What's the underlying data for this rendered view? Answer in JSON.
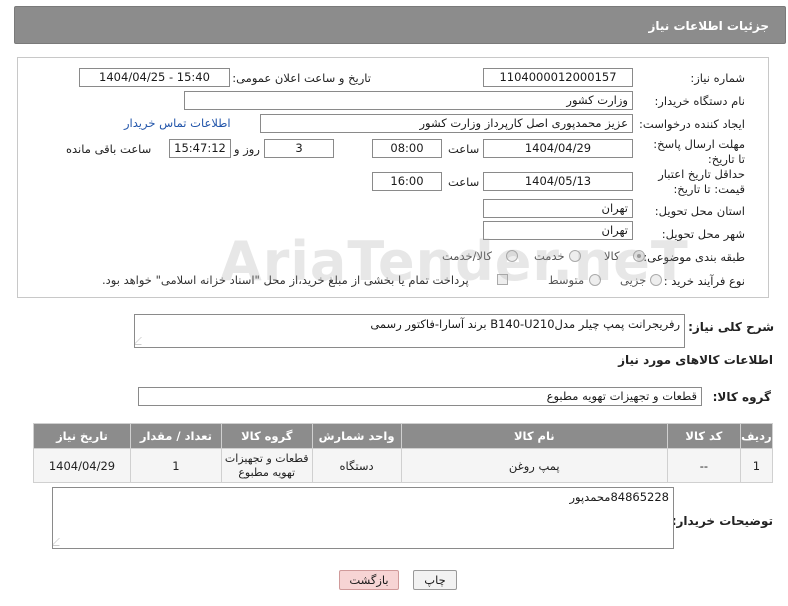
{
  "header": {
    "title": "جزئیات اطلاعات نیاز"
  },
  "form": {
    "need_number_label": "شماره نیاز:",
    "need_number": "1104000012000157",
    "announce_label": "تاریخ و ساعت اعلان عمومی:",
    "announce_value": "1404/04/25 - 15:40",
    "buyer_org_label": "نام دستگاه خریدار:",
    "buyer_org": "وزارت کشور",
    "requester_label": "ایجاد کننده درخواست:",
    "requester": "عزیز محمدپوری اصل کارپرداز وزارت کشور",
    "buyer_contact_link": "اطلاعات تماس خریدار",
    "reply_deadline_label": "مهلت ارسال پاسخ: تا تاریخ:",
    "reply_date": "1404/04/29",
    "time_label": "ساعت",
    "reply_time": "08:00",
    "days_value": "3",
    "days_label": "روز و",
    "remaining_time": "15:47:12",
    "remaining_label": "ساعت باقی مانده",
    "price_validity_label": "حداقل تاریخ اعتبار قیمت: تا تاریخ:",
    "price_date": "1404/05/13",
    "price_time": "16:00",
    "province_label": "استان محل تحویل:",
    "province": "تهران",
    "city_label": "شهر محل تحویل:",
    "city": "تهران",
    "category_label": "طبقه بندی موضوعی:",
    "category_options": [
      "کالا",
      "خدمت",
      "کالا/خدمت"
    ],
    "process_label": "نوع فرآیند خرید :",
    "process_options": [
      "جزیی",
      "متوسط"
    ],
    "payment_note": "پرداخت تمام یا بخشی از مبلغ خرید،از محل \"اسناد خزانه اسلامی\" خواهد بود."
  },
  "description": {
    "label": "شرح کلی نیاز:",
    "value": "رفریجرانت پمپ چیلر مدلB140-U210 برند آسارا-فاکتور رسمی"
  },
  "goods": {
    "section_title": "اطلاعات کالاهای مورد نیاز",
    "group_label": "گروه کالا:",
    "group_value": "قطعات و تجهیزات تهویه مطبوع",
    "columns": [
      "ردیف",
      "کد کالا",
      "نام کالا",
      "واحد شمارش",
      "گروه کالا",
      "تعداد / مقدار",
      "تاریخ نیاز"
    ],
    "rows": [
      {
        "row": "1",
        "code": "--",
        "name": "پمپ روغن",
        "unit": "دستگاه",
        "group": "قطعات و تجهیزات تهویه مطبوع",
        "qty": "1",
        "date": "1404/04/29"
      }
    ]
  },
  "buyer_notes": {
    "label": "توضیحات خریدار:",
    "value": "84865228محمدپور"
  },
  "buttons": {
    "print": "چاپ",
    "back": "بازگشت"
  },
  "watermark": "AriaTender.neT",
  "colors": {
    "header_bg": "#8c8c8c",
    "link": "#2255aa",
    "back_button": "#f7d4d4"
  }
}
